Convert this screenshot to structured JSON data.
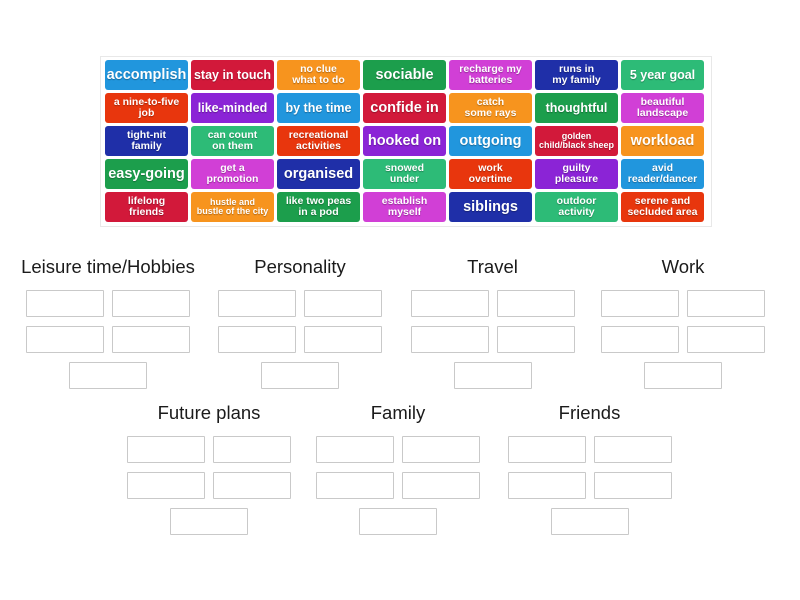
{
  "activity": {
    "type": "group-sort",
    "tile_bank": {
      "rows": [
        [
          {
            "text": "accomplish",
            "color": "#2196dd",
            "size": "lg"
          },
          {
            "text": "stay in touch",
            "color": "#d2193a",
            "size": "md"
          },
          {
            "text": "no clue\nwhat to do",
            "color": "#f7941e",
            "size": "sm"
          },
          {
            "text": "sociable",
            "color": "#1c9e4c",
            "size": "lg"
          },
          {
            "text": "recharge my\nbatteries",
            "color": "#d13fd6",
            "size": "sm"
          },
          {
            "text": "runs in\nmy family",
            "color": "#1f2fa8",
            "size": "sm"
          },
          {
            "text": "5 year goal",
            "color": "#2dbb77",
            "size": "md"
          }
        ],
        [
          {
            "text": "a nine-to-five\njob",
            "color": "#e8360d",
            "size": "sm"
          },
          {
            "text": "like-minded",
            "color": "#8b24d6",
            "size": "md"
          },
          {
            "text": "by the time",
            "color": "#2196dd",
            "size": "md"
          },
          {
            "text": "confide in",
            "color": "#d2193a",
            "size": "lg"
          },
          {
            "text": "catch\nsome rays",
            "color": "#f7941e",
            "size": "sm"
          },
          {
            "text": "thoughtful",
            "color": "#1c9e4c",
            "size": "md"
          },
          {
            "text": "beautiful\nlandscape",
            "color": "#d13fd6",
            "size": "sm"
          }
        ],
        [
          {
            "text": "tight-nit\nfamily",
            "color": "#1f2fa8",
            "size": "sm"
          },
          {
            "text": "can count\non them",
            "color": "#2dbb77",
            "size": "sm"
          },
          {
            "text": "recreational\nactivities",
            "color": "#e8360d",
            "size": "sm"
          },
          {
            "text": "hooked on",
            "color": "#8b24d6",
            "size": "lg"
          },
          {
            "text": "outgoing",
            "color": "#2196dd",
            "size": "lg"
          },
          {
            "text": "golden\nchild/black sheep",
            "color": "#d2193a",
            "size": "xs"
          },
          {
            "text": "workload",
            "color": "#f7941e",
            "size": "lg"
          }
        ],
        [
          {
            "text": "easy-going",
            "color": "#1c9e4c",
            "size": "lg"
          },
          {
            "text": "get a\npromotion",
            "color": "#d13fd6",
            "size": "sm"
          },
          {
            "text": "organised",
            "color": "#1f2fa8",
            "size": "lg"
          },
          {
            "text": "snowed\nunder",
            "color": "#2dbb77",
            "size": "sm"
          },
          {
            "text": "work\novertime",
            "color": "#e8360d",
            "size": "sm"
          },
          {
            "text": "guilty\npleasure",
            "color": "#8b24d6",
            "size": "sm"
          },
          {
            "text": "avid\nreader/dancer",
            "color": "#2196dd",
            "size": "sm"
          }
        ],
        [
          {
            "text": "lifelong\nfriends",
            "color": "#d2193a",
            "size": "sm"
          },
          {
            "text": "hustle and\nbustle of the city",
            "color": "#f7941e",
            "size": "xs"
          },
          {
            "text": "like two peas\nin a pod",
            "color": "#1c9e4c",
            "size": "sm"
          },
          {
            "text": "establish\nmyself",
            "color": "#d13fd6",
            "size": "sm"
          },
          {
            "text": "siblings",
            "color": "#1f2fa8",
            "size": "lg"
          },
          {
            "text": "outdoor\nactivity",
            "color": "#2dbb77",
            "size": "sm"
          },
          {
            "text": "serene and\nsecluded area",
            "color": "#e8360d",
            "size": "sm"
          }
        ]
      ]
    },
    "categories": [
      {
        "title": "Leisure time/Hobbies",
        "slot_rows": [
          2,
          2,
          1
        ]
      },
      {
        "title": "Personality",
        "slot_rows": [
          2,
          2,
          1
        ]
      },
      {
        "title": "Travel",
        "slot_rows": [
          2,
          2,
          1
        ]
      },
      {
        "title": "Work",
        "slot_rows": [
          2,
          2,
          1
        ]
      },
      {
        "title": "Future plans",
        "slot_rows": [
          2,
          2,
          1
        ]
      },
      {
        "title": "Family",
        "slot_rows": [
          2,
          2,
          1
        ]
      },
      {
        "title": "Friends",
        "slot_rows": [
          2,
          2,
          1
        ]
      }
    ],
    "theme": {
      "background": "#ffffff",
      "slot_border": "#c9c9c9",
      "bank_border": "#e8e8e8",
      "title_color": "#1b1b1b"
    }
  }
}
